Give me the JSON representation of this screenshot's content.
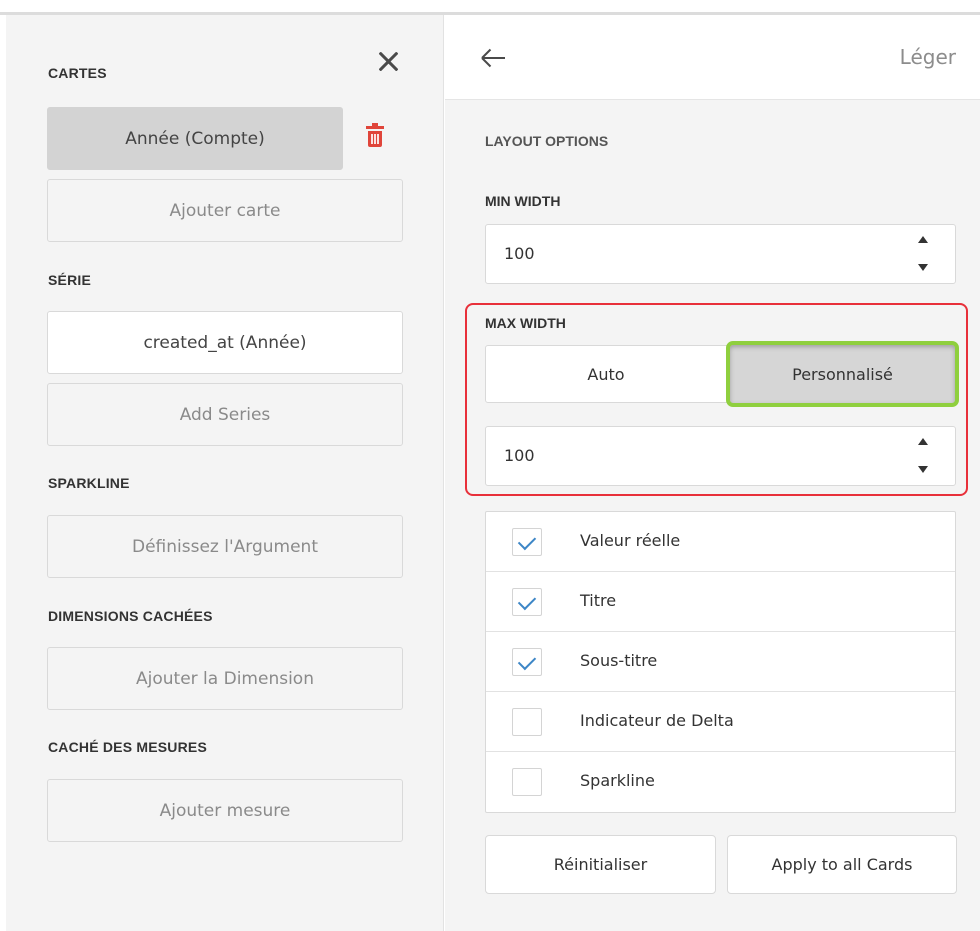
{
  "left_panel": {
    "cards": {
      "section_label": "CARTES",
      "items": [
        {
          "label": "Année (Compte)",
          "selected": true
        }
      ],
      "add_label": "Ajouter carte"
    },
    "series": {
      "section_label": "SÉRIE",
      "items": [
        {
          "label": "created_at (Année)"
        }
      ],
      "add_label": "Add Series"
    },
    "sparkline": {
      "section_label": "SPARKLINE",
      "set_argument_label": "Définissez l'Argument"
    },
    "hidden_dimensions": {
      "section_label": "DIMENSIONS CACHÉES",
      "add_label": "Ajouter la Dimension"
    },
    "hidden_measures": {
      "section_label": "CACHÉ DES MESURES",
      "add_label": "Ajouter mesure"
    },
    "icons": {
      "close": "close-icon",
      "delete": "trash-icon"
    },
    "delete_color": "#e0453a"
  },
  "right_panel": {
    "header": {
      "title": "Léger",
      "back_icon": "arrow-left-icon"
    },
    "layout_options_label": "LAYOUT OPTIONS",
    "min_width": {
      "label": "MIN WIDTH",
      "value": "100"
    },
    "max_width": {
      "label": "MAX WIDTH",
      "mode_options": [
        "Auto",
        "Personnalisé"
      ],
      "selected_mode": "Personnalisé",
      "value": "100"
    },
    "checkboxes": [
      {
        "label": "Valeur réelle",
        "checked": true
      },
      {
        "label": "Titre",
        "checked": true
      },
      {
        "label": "Sous-titre",
        "checked": true
      },
      {
        "label": "Indicateur de Delta",
        "checked": false
      },
      {
        "label": "Sparkline",
        "checked": false
      }
    ],
    "buttons": {
      "reset": "Réinitialiser",
      "apply_all": "Apply to all Cards"
    },
    "highlight_colors": {
      "red_frame": "#e8303a",
      "green_frame": "#8fcf3e",
      "check": "#3d86c6"
    }
  }
}
